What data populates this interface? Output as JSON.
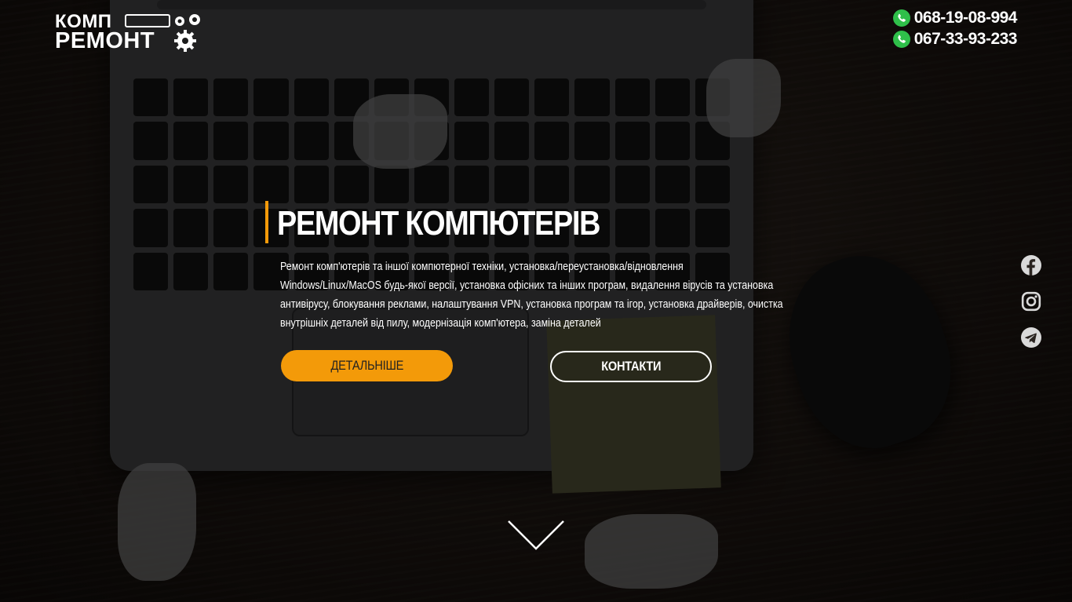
{
  "brand": {
    "logo_top": "КОМП",
    "logo_bottom": "РЕМОНТ"
  },
  "header": {
    "phones": [
      "068-19-08-994",
      "067-33-93-233"
    ]
  },
  "hero": {
    "title": "РЕМОНТ КОМПЮТЕРІВ",
    "description": "Ремонт комп'ютерів та іншої компютерної техніки, установка/переустановка/відновлення Windows/Linux/MacOS будь-якої версії, установка офісних та інших програм, видалення вірусів та установка антивірусу, блокування реклами, налаштування VPN, установка програм та ігор, установка драйверів, очистка внутрішніх деталей від пилу, модернізація комп'ютера, заміна деталей",
    "primary_button": "ДЕТАЛЬНІШЕ",
    "secondary_button": "КОНТАКТИ"
  },
  "social": [
    "facebook-icon",
    "instagram-icon",
    "telegram-icon"
  ],
  "colors": {
    "accent": "#f39a09",
    "phone_icon": "#2fbf4a",
    "social_icon": "#d9d9d9"
  }
}
